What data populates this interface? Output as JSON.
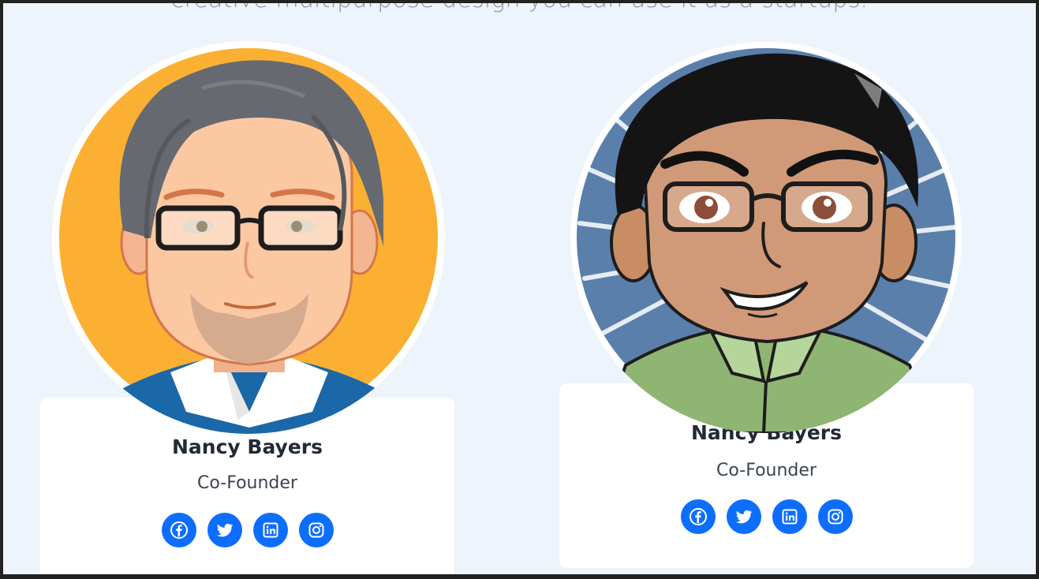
{
  "section": {
    "subtitle": "creative multipurpose design you can use it as a startups."
  },
  "colors": {
    "accent": "#0d6efd",
    "background": "#eef4fc",
    "card": "#ffffff"
  },
  "team": [
    {
      "name": "Nancy Bayers",
      "role": "Co-Founder",
      "avatar": "cartoon-man-gray-hair-glasses-avatar",
      "socials": [
        "facebook-icon",
        "twitter-icon",
        "linkedin-icon",
        "instagram-icon"
      ]
    },
    {
      "name": "Nancy Bayers",
      "role": "Co-Founder",
      "avatar": "cartoon-man-black-hair-glasses-avatar",
      "socials": [
        "facebook-icon",
        "twitter-icon",
        "linkedin-icon",
        "instagram-icon"
      ]
    }
  ]
}
